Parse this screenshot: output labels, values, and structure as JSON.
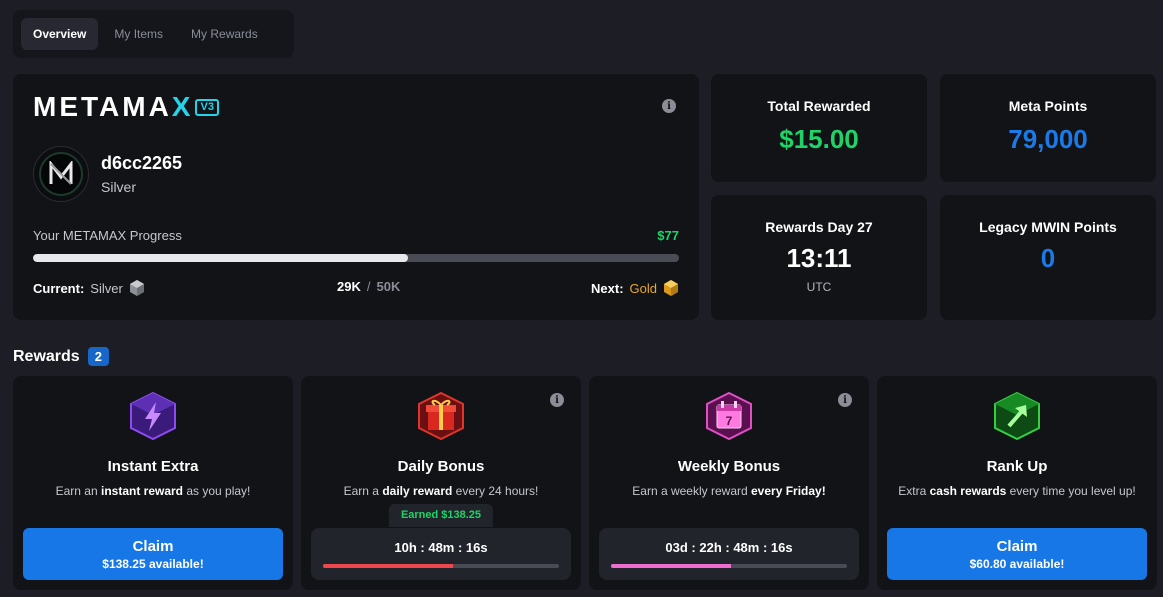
{
  "tabs": [
    {
      "label": "Overview",
      "active": true
    },
    {
      "label": "My Items",
      "active": false
    },
    {
      "label": "My Rewards",
      "active": false
    }
  ],
  "profile": {
    "logo_text": "METAMA",
    "logo_x": "X",
    "logo_version": "V3",
    "avatar_monogram": "M",
    "username": "d6cc2265",
    "tier": "Silver",
    "progress_label": "Your METAMAX Progress",
    "progress_amount": "$77",
    "progress_fraction": 0.58,
    "current_label": "Current:",
    "current_tier": "Silver",
    "xp_current": "29K",
    "xp_separator": "/",
    "xp_target": "50K",
    "next_label": "Next:",
    "next_tier": "Gold"
  },
  "stats": [
    {
      "title": "Total Rewarded",
      "value": "$15.00",
      "color": "#1fd366"
    },
    {
      "title": "Meta Points",
      "value": "79,000",
      "color": "#1c7ae8"
    },
    {
      "title": "Rewards Day 27",
      "value": "13:11",
      "sub": "UTC",
      "color": "#ffffff"
    },
    {
      "title": "Legacy MWIN Points",
      "value": "0",
      "color": "#1c7ae8"
    }
  ],
  "rewards_section": {
    "title": "Rewards",
    "count": "2"
  },
  "rewards": [
    {
      "title": "Instant Extra",
      "desc_pre": "Earn an ",
      "desc_bold": "instant reward",
      "desc_post": " as you play!",
      "icon": "lightning-icon",
      "claim_label": "Claim",
      "claim_sub": "$138.25 available!"
    },
    {
      "title": "Daily Bonus",
      "desc_pre": "Earn a ",
      "desc_bold": "daily reward",
      "desc_post": " every 24 hours!",
      "icon": "gift-icon",
      "earned": "Earned $138.25",
      "timer": "10h : 48m : 16s",
      "timer_fraction": 0.55,
      "timer_color": "#f0474c"
    },
    {
      "title": "Weekly Bonus",
      "desc_pre": "Earn a weekly reward ",
      "desc_bold": "every Friday!",
      "desc_post": "",
      "icon": "calendar-icon",
      "calendar_day": "7",
      "timer": "03d : 22h : 48m : 16s",
      "timer_fraction": 0.51,
      "timer_color": "#f06ccf"
    },
    {
      "title": "Rank Up",
      "desc_pre": "Extra ",
      "desc_bold": "cash rewards",
      "desc_post": " every time you level up!",
      "icon": "arrow-up-icon",
      "claim_label": "Claim",
      "claim_sub": "$60.80 available!"
    }
  ],
  "info_icon_glyph": "i",
  "colors": {
    "accent_blue": "#1877e6",
    "green": "#1fd366",
    "gold": "#e9a82a",
    "cyan": "#24d3ea"
  }
}
